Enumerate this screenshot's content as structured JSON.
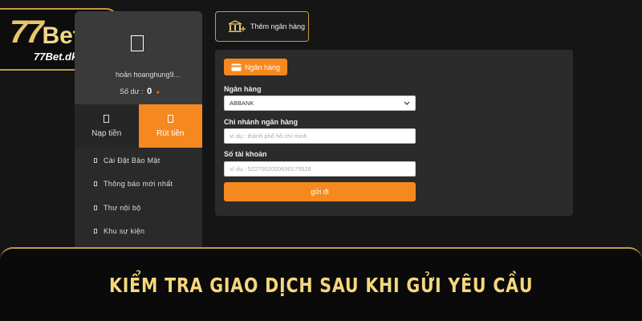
{
  "logo": {
    "main_number": "77",
    "main_word": "Bet",
    "subtitle": "77Bet.dk"
  },
  "account": {
    "name_label": "hoản hoanghung9...",
    "balance_label": "Số dư :",
    "balance_value": "0",
    "user_icon": "user-icon"
  },
  "actions": {
    "deposit_label": "Nạp tiền",
    "withdraw_label": "Rút tiền"
  },
  "menu": {
    "items": [
      {
        "label": "Cài Đặt Bảo Mật"
      },
      {
        "label": "Thông báo mới nhất"
      },
      {
        "label": "Thư nội bộ"
      },
      {
        "label": "Khu sự kiện"
      }
    ]
  },
  "add_bank": {
    "label": "Thêm ngân hàng",
    "icon": "bank-icon"
  },
  "form": {
    "tab_label": "Ngân hàng",
    "bank_label": "Ngân hàng",
    "bank_value": "ABBANK",
    "branch_label": "Chi nhánh ngân hàng",
    "branch_placeholder": "ví dụ : thành phố hồ chí minh",
    "account_label": "Số tài khoản",
    "account_placeholder": "ví dụ : 5227002020690175526",
    "submit_label": "gửi đi"
  },
  "banner": {
    "text": "KIỂM TRA GIAO DỊCH SAU KHI GỬI YÊU CẦU"
  },
  "colors": {
    "accent_orange": "#f5881f",
    "gold_border": "#c59a3b",
    "banner_text": "#f6d77c",
    "background": "#151515"
  }
}
